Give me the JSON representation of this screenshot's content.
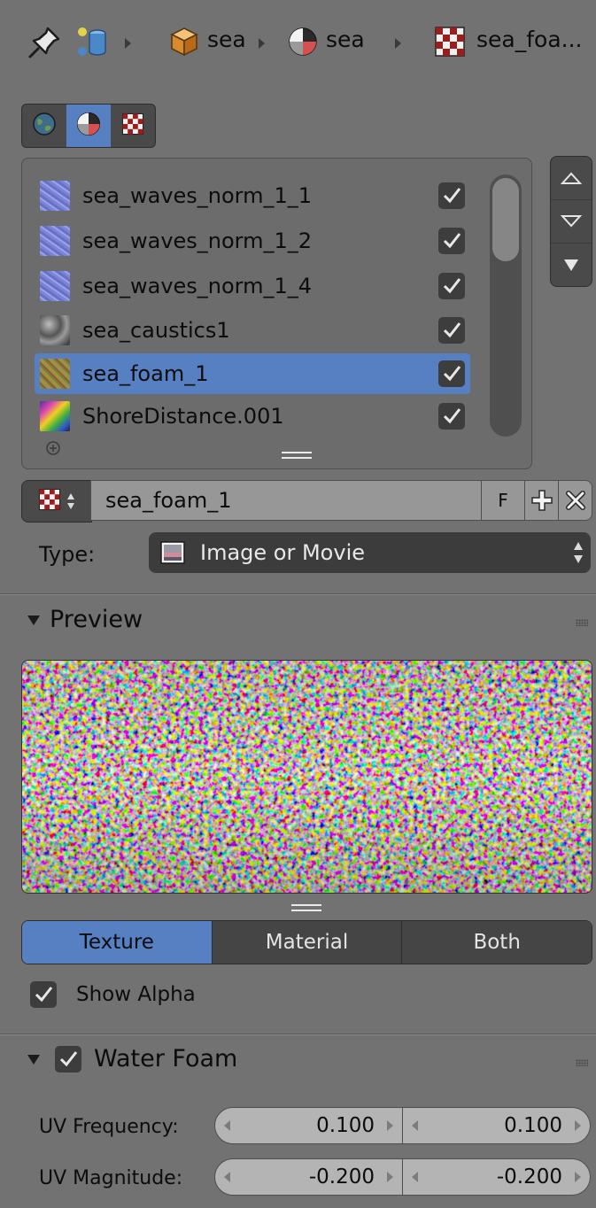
{
  "breadcrumb": {
    "items": [
      {
        "icon": "pin-icon"
      },
      {
        "icon": "scene-data-icon"
      },
      {
        "icon": "object-cube-icon",
        "label": "sea"
      },
      {
        "icon": "material-sphere-icon",
        "label": "sea"
      },
      {
        "icon": "texture-checker-icon",
        "label": "sea_foa..."
      }
    ]
  },
  "context_tabs": [
    {
      "name": "world",
      "icon": "world-icon",
      "active": false
    },
    {
      "name": "material",
      "icon": "material-sphere-icon",
      "active": true
    },
    {
      "name": "texture",
      "icon": "texture-checker-icon",
      "active": false
    }
  ],
  "texture_slots": [
    {
      "label": "sea_waves_norm_1_1",
      "checked": true,
      "selected": false,
      "thumb": "blue-noise"
    },
    {
      "label": "sea_waves_norm_1_2",
      "checked": true,
      "selected": false,
      "thumb": "blue-noise"
    },
    {
      "label": "sea_waves_norm_1_4",
      "checked": true,
      "selected": false,
      "thumb": "blue-noise"
    },
    {
      "label": "sea_caustics1",
      "checked": true,
      "selected": false,
      "thumb": "gray-noise"
    },
    {
      "label": "sea_foam_1",
      "checked": true,
      "selected": true,
      "thumb": "color-noise"
    },
    {
      "label": "ShoreDistance.001",
      "checked": true,
      "selected": false,
      "thumb": "gradient"
    }
  ],
  "texture_id": {
    "name": "sea_foam_1",
    "fake_user": "F"
  },
  "type": {
    "label": "Type:",
    "value": "Image or Movie"
  },
  "preview_panel": {
    "title": "Preview",
    "modes": [
      "Texture",
      "Material",
      "Both"
    ],
    "active_mode": "Texture",
    "show_alpha_label": "Show Alpha",
    "show_alpha": true
  },
  "water_foam_panel": {
    "title": "Water Foam",
    "enabled": true,
    "uv_frequency": {
      "label": "UV Frequency:",
      "x": "0.100",
      "y": "0.100"
    },
    "uv_magnitude": {
      "label": "UV Magnitude:",
      "x": "-0.200",
      "y": "-0.200"
    }
  },
  "colors": {
    "background": "#727272",
    "accent": "#5680c2",
    "dark_widget": "#3d3d3d"
  }
}
